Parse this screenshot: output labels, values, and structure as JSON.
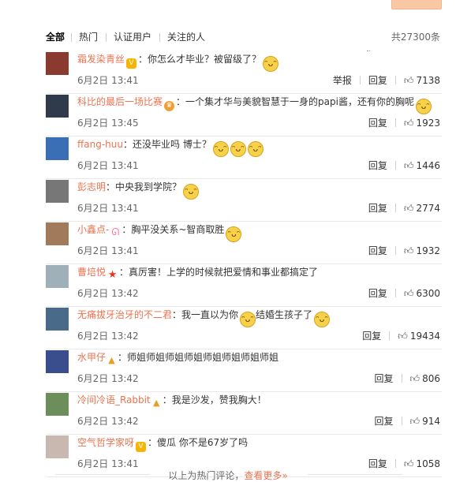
{
  "tabs": [
    {
      "label": "全部"
    },
    {
      "label": "热门"
    },
    {
      "label": "认证用户"
    },
    {
      "label": "关注的人"
    }
  ],
  "total_label": "共27300条",
  "actions": {
    "report": "举报",
    "reply": "回复"
  },
  "comments": [
    {
      "user": "霜发染青丝",
      "badge": "vip",
      "text": "：你怎么才毕业？被留级了？",
      "emojis": 1,
      "time": "6月2日 13:41",
      "likes": "7138",
      "report": true,
      "avatar_color": "#8a3a2e"
    },
    {
      "user": "科比的最后一场比赛",
      "badge": "crown",
      "text": "：一个集才华与美貌智慧于一身的papi酱，还有你的胸呢",
      "emojis": 1,
      "time": "6月2日 13:45",
      "likes": "1923",
      "report": false,
      "avatar_color": "#2f3a4a"
    },
    {
      "user": "ffang-huu",
      "badge": "",
      "text": "：还没毕业吗 博士？",
      "emojis": 3,
      "time": "6月2日 13:41",
      "likes": "1446",
      "report": false,
      "avatar_color": "#3b6fb5"
    },
    {
      "user": "彭志明",
      "badge": "",
      "text": "：中央我到学院？",
      "emojis": 1,
      "time": "6月2日 13:41",
      "likes": "2774",
      "report": false,
      "avatar_color": "#777777"
    },
    {
      "user": "小鑫点-",
      "badge": "bunny",
      "text": "：胸平没关系~智商取胜",
      "emojis": 1,
      "time": "6月2日 13:41",
      "likes": "1932",
      "report": false,
      "avatar_color": "#a07a5a"
    },
    {
      "user": "曹培悦",
      "badge": "star",
      "text": "：真厉害！上学的时候就把爱情和事业都搞定了",
      "emojis": 0,
      "time": "6月2日 13:42",
      "likes": "6300",
      "report": false,
      "avatar_color": "#9fb0b8"
    },
    {
      "user": "无痛拔牙治牙的不二君",
      "badge": "",
      "text": "：我一直以为你",
      "text2": "结婚生孩子了",
      "emojis": 1,
      "time": "6月2日 13:42",
      "likes": "19434",
      "report": false,
      "avatar_color": "#4a6a8a"
    },
    {
      "user": "水甲仔",
      "badge": "party",
      "text": "：师姐师姐师姐师姐师姐师姐师姐师姐",
      "emojis": 0,
      "time": "6月2日 13:42",
      "likes": "806",
      "report": false,
      "avatar_color": "#3a4d8c"
    },
    {
      "user": "冷间冷语_Rabbit",
      "badge": "party",
      "text": "：我是沙发，赞我胸大！",
      "emojis": 0,
      "time": "6月2日 13:42",
      "likes": "914",
      "report": false,
      "avatar_color": "#6b8e5a"
    },
    {
      "user": "空气哲学家呀",
      "badge": "vip",
      "text": "：傻瓜  你不是67岁了吗",
      "emojis": 0,
      "time": "6月2日 13:41",
      "likes": "1058",
      "report": false,
      "avatar_color": "#c9b8b0"
    }
  ],
  "footer": {
    "text": "以上为热门评论，",
    "link": "查看更多»"
  },
  "colors": {
    "username": "#eb7350",
    "accent_button": "#f9c7a3"
  }
}
